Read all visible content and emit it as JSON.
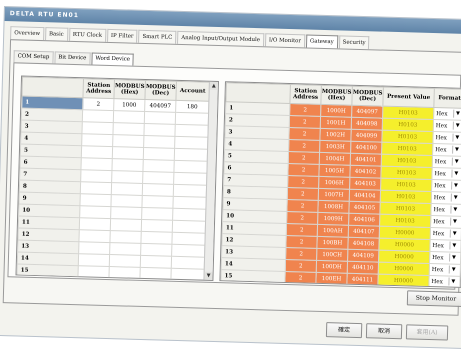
{
  "window": {
    "title": "DELTA RTU EN01"
  },
  "main_tabs": [
    {
      "label": "Overview",
      "active": false
    },
    {
      "label": "Basic",
      "active": false
    },
    {
      "label": "RTU Clock",
      "active": false
    },
    {
      "label": "IP Filter",
      "active": false
    },
    {
      "label": "Smart PLC",
      "active": false
    },
    {
      "label": "Analog Input/Output Module",
      "active": false
    },
    {
      "label": "I/O Monitor",
      "active": false
    },
    {
      "label": "Gateway",
      "active": true
    },
    {
      "label": "Security",
      "active": false
    }
  ],
  "sub_tabs": [
    {
      "label": "COM Setup",
      "active": false
    },
    {
      "label": "Bit Device",
      "active": false
    },
    {
      "label": "Word Device",
      "active": true
    }
  ],
  "left_table": {
    "headers": [
      "Station Address",
      "MODBUS (Hex)",
      "MODBUS (Dec)",
      "Account"
    ],
    "rows": [
      {
        "n": "1",
        "station": "2",
        "hex": "1000",
        "dec": "404097",
        "account": "180"
      },
      {
        "n": "2",
        "station": "",
        "hex": "",
        "dec": "",
        "account": ""
      },
      {
        "n": "3",
        "station": "",
        "hex": "",
        "dec": "",
        "account": ""
      },
      {
        "n": "4",
        "station": "",
        "hex": "",
        "dec": "",
        "account": ""
      },
      {
        "n": "5",
        "station": "",
        "hex": "",
        "dec": "",
        "account": ""
      },
      {
        "n": "6",
        "station": "",
        "hex": "",
        "dec": "",
        "account": ""
      },
      {
        "n": "7",
        "station": "",
        "hex": "",
        "dec": "",
        "account": ""
      },
      {
        "n": "8",
        "station": "",
        "hex": "",
        "dec": "",
        "account": ""
      },
      {
        "n": "9",
        "station": "",
        "hex": "",
        "dec": "",
        "account": ""
      },
      {
        "n": "10",
        "station": "",
        "hex": "",
        "dec": "",
        "account": ""
      },
      {
        "n": "11",
        "station": "",
        "hex": "",
        "dec": "",
        "account": ""
      },
      {
        "n": "12",
        "station": "",
        "hex": "",
        "dec": "",
        "account": ""
      },
      {
        "n": "13",
        "station": "",
        "hex": "",
        "dec": "",
        "account": ""
      },
      {
        "n": "14",
        "station": "",
        "hex": "",
        "dec": "",
        "account": ""
      },
      {
        "n": "15",
        "station": "",
        "hex": "",
        "dec": "",
        "account": ""
      }
    ]
  },
  "right_table": {
    "headers": [
      "Station Address",
      "MODBUS (Hex)",
      "MODBUS (Dec)",
      "Present Value",
      "Format"
    ],
    "rows": [
      {
        "n": "1",
        "station": "2",
        "hex": "1000H",
        "dec": "404097",
        "value": "H0103",
        "format": "Hex"
      },
      {
        "n": "2",
        "station": "2",
        "hex": "1001H",
        "dec": "404098",
        "value": "H0103",
        "format": "Hex"
      },
      {
        "n": "3",
        "station": "2",
        "hex": "1002H",
        "dec": "404099",
        "value": "H0103",
        "format": "Hex"
      },
      {
        "n": "4",
        "station": "2",
        "hex": "1003H",
        "dec": "404100",
        "value": "H0103",
        "format": "Hex"
      },
      {
        "n": "5",
        "station": "2",
        "hex": "1004H",
        "dec": "404101",
        "value": "H0103",
        "format": "Hex"
      },
      {
        "n": "6",
        "station": "2",
        "hex": "1005H",
        "dec": "404102",
        "value": "H0103",
        "format": "Hex"
      },
      {
        "n": "7",
        "station": "2",
        "hex": "1006H",
        "dec": "404103",
        "value": "H0103",
        "format": "Hex"
      },
      {
        "n": "8",
        "station": "2",
        "hex": "1007H",
        "dec": "404104",
        "value": "H0103",
        "format": "Hex"
      },
      {
        "n": "9",
        "station": "2",
        "hex": "1008H",
        "dec": "404105",
        "value": "H0103",
        "format": "Hex"
      },
      {
        "n": "10",
        "station": "2",
        "hex": "1009H",
        "dec": "404106",
        "value": "H0103",
        "format": "Hex"
      },
      {
        "n": "11",
        "station": "2",
        "hex": "100AH",
        "dec": "404107",
        "value": "H0000",
        "format": "Hex"
      },
      {
        "n": "12",
        "station": "2",
        "hex": "100BH",
        "dec": "404108",
        "value": "H0000",
        "format": "Hex"
      },
      {
        "n": "13",
        "station": "2",
        "hex": "100CH",
        "dec": "404109",
        "value": "H0000",
        "format": "Hex"
      },
      {
        "n": "14",
        "station": "2",
        "hex": "100DH",
        "dec": "404110",
        "value": "H0000",
        "format": "Hex"
      },
      {
        "n": "15",
        "station": "2",
        "hex": "100EH",
        "dec": "404111",
        "value": "H0000",
        "format": "Hex"
      }
    ]
  },
  "buttons": {
    "stop_monitor": "Stop Monitor",
    "ok": "確定",
    "cancel": "取消",
    "apply": "套用(A)"
  },
  "colors": {
    "address_cell": "#f0844e",
    "value_cell": "#f5ef2c",
    "titlebar": "#5f84a8"
  }
}
